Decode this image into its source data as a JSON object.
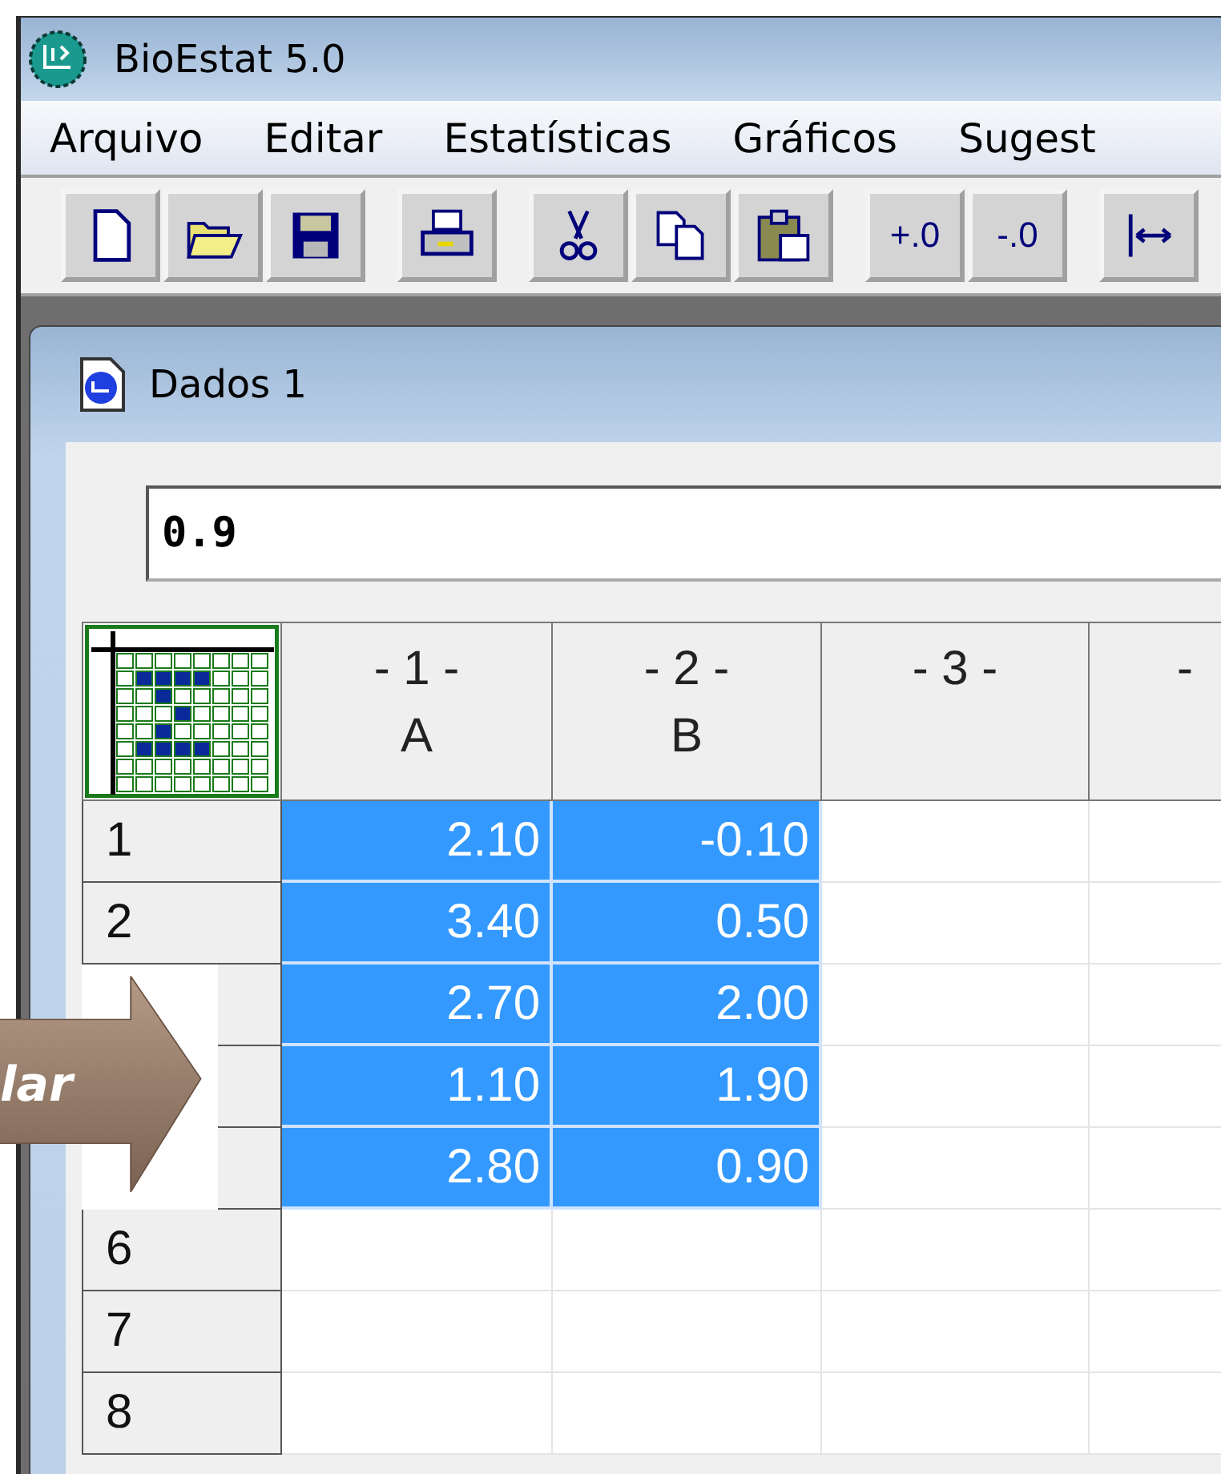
{
  "window": {
    "title": "BioEstat 5.0"
  },
  "menu": [
    "Arquivo",
    "Editar",
    "Estatísticas",
    "Gráficos",
    "Sugest"
  ],
  "toolbar": [
    [
      {
        "kind": "icon"
      },
      {
        "kind": "icon"
      },
      {
        "kind": "icon"
      }
    ],
    [
      {
        "kind": "icon"
      }
    ],
    [
      {
        "kind": "icon"
      },
      {
        "kind": "icon"
      },
      {
        "kind": "icon"
      }
    ],
    [
      {
        "kind": "text",
        "label": "+.0"
      },
      {
        "kind": "text",
        "label": "-.0"
      }
    ],
    [
      {
        "kind": "icon"
      }
    ]
  ],
  "document": {
    "title": "Dados 1",
    "cell_input": "0.9",
    "columns": [
      {
        "number": "- 1 -",
        "letter": "A"
      },
      {
        "number": "- 2 -",
        "letter": "B"
      },
      {
        "number": "- 3 -"
      },
      {
        "number": "-"
      }
    ],
    "rows": [
      {
        "label": "1",
        "cells": [
          {
            "value": "2.10",
            "selected": true
          },
          {
            "value": "-0.10",
            "selected": true
          },
          {
            "selected": false
          },
          {
            "selected": false
          }
        ]
      },
      {
        "label": "2",
        "cells": [
          {
            "value": "3.40",
            "selected": true
          },
          {
            "value": "0.50",
            "selected": true
          },
          {
            "selected": false
          },
          {
            "selected": false
          }
        ]
      },
      {
        "cells": [
          {
            "value": "2.70",
            "selected": true
          },
          {
            "value": "2.00",
            "selected": true
          },
          {
            "selected": false
          },
          {
            "selected": false
          }
        ]
      },
      {
        "cells": [
          {
            "value": "1.10",
            "selected": true
          },
          {
            "value": "1.90",
            "selected": true
          },
          {
            "selected": false
          },
          {
            "selected": false
          }
        ]
      },
      {
        "cells": [
          {
            "value": "2.80",
            "selected": true
          },
          {
            "value": "0.90",
            "selected": true
          },
          {
            "selected": false
          },
          {
            "selected": false
          }
        ]
      },
      {
        "label": "6",
        "cells": [
          {
            "selected": false
          },
          {
            "selected": false
          },
          {
            "selected": false
          },
          {
            "selected": false
          }
        ]
      },
      {
        "label": "7",
        "cells": [
          {
            "selected": false
          },
          {
            "selected": false
          },
          {
            "selected": false
          },
          {
            "selected": false
          }
        ]
      },
      {
        "label": "8",
        "cells": [
          {
            "selected": false
          },
          {
            "selected": false
          },
          {
            "selected": false
          },
          {
            "selected": false
          }
        ]
      }
    ]
  },
  "callout": {
    "label": "lar"
  }
}
